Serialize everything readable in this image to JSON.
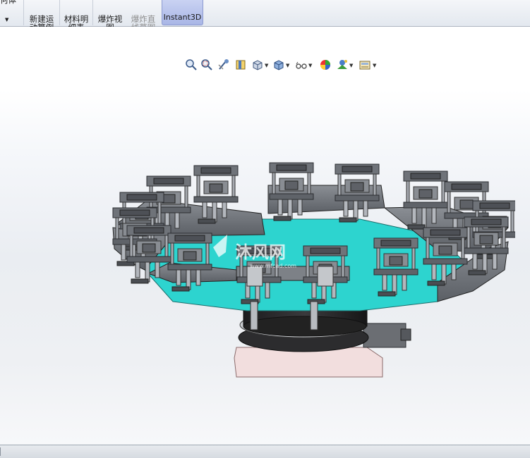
{
  "ribbon": {
    "ghost_label": "何体",
    "motion_study": "新建运\n动算例",
    "bom": "材料明\n细表",
    "exploded_view": "爆炸视\n图",
    "explode_line_sketch": "爆炸直\n线草图",
    "instant3d": "Instant3D"
  },
  "hud": {
    "icons": [
      "zoom-to-fit-icon",
      "zoom-to-area-icon",
      "previous-view-icon",
      "section-view-icon",
      "view-orientation-icon",
      "display-style-icon",
      "hide-show-items-icon",
      "edit-appearance-icon",
      "apply-scene-icon",
      "view-settings-icon"
    ]
  },
  "watermark": {
    "text": "沐风网",
    "url": "www.mfcad.com"
  },
  "colors": {
    "accent": "#2dd4cf",
    "part_gray": "#6e7278",
    "base_pink": "#f2dede",
    "instant3d_bg": "#b9c4ee"
  }
}
